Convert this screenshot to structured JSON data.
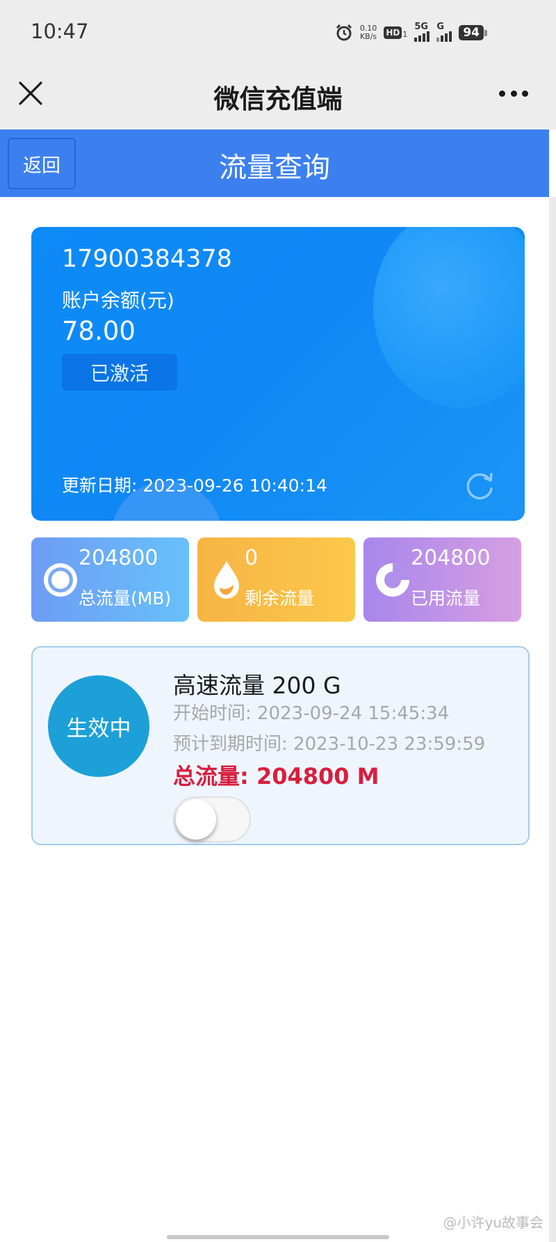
{
  "status_bar": {
    "time": "10:47",
    "net_speed_value": "0.10",
    "net_speed_unit": "KB/s",
    "hd_label": "HD",
    "hd_sub": "1",
    "signal1_label": "5G",
    "signal2_label": "G",
    "battery": "94"
  },
  "wechat_nav": {
    "title": "微信充值端",
    "close_icon": "close-icon",
    "more_icon": "more-icon"
  },
  "header": {
    "back_label": "返回",
    "title": "流量查询",
    "background": "#3c80f0"
  },
  "account": {
    "phone_number": "17900384378",
    "balance_label": "账户余额(元)",
    "balance_value": "78.00",
    "status": "已激活",
    "update_date": "更新日期: 2023-09-26 10:40:14",
    "refresh_icon": "refresh-icon",
    "background": "#0f88f6"
  },
  "stats": [
    {
      "value": "204800",
      "label": "总流量(MB)",
      "icon": "target-icon"
    },
    {
      "value": "0",
      "label": "剩余流量",
      "icon": "drop-icon"
    },
    {
      "value": "204800",
      "label": "已用流量",
      "icon": "pie-icon"
    }
  ],
  "package": {
    "badge": "生效中",
    "name": "高速流量 200 G",
    "start_time": "开始时间: 2023-09-24 15:45:34",
    "expire_time": "预计到期时间: 2023-10-23 23:59:59",
    "total": "总流量: 204800 M",
    "toggle_on": false,
    "total_color": "#d81e3e"
  },
  "watermark": "@小许yu故事会"
}
